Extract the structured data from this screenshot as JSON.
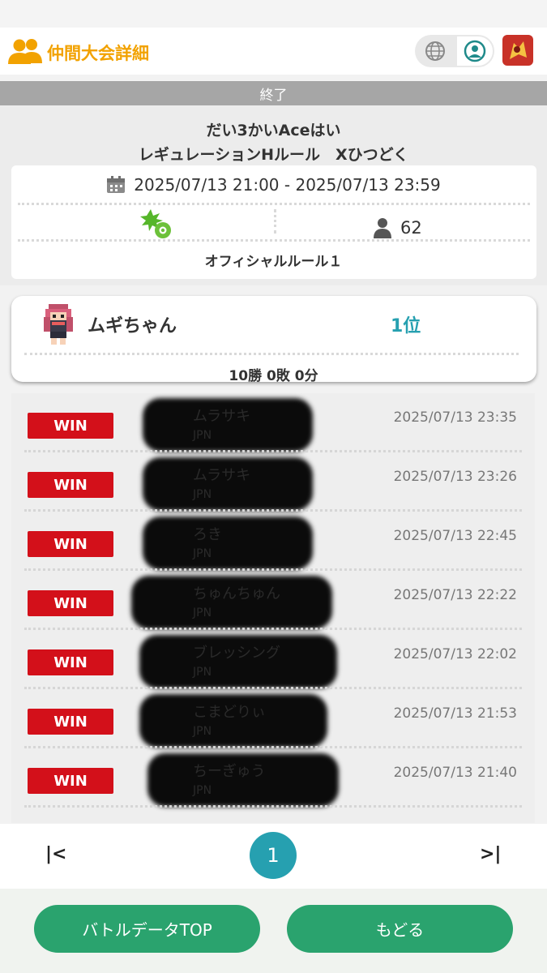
{
  "header": {
    "title": "仲間大会詳細",
    "icons": {
      "left": "people-icon",
      "lang": "globe-icon",
      "profile": "user-circle-icon",
      "app": "app-icon"
    },
    "accent_color": "#f2a200"
  },
  "event": {
    "status": "終了",
    "name": "だい3かいAceはい",
    "rule": "レギュレーションHルール　Xひつどく",
    "date_range": "2025/07/13 21:00 - 2025/07/13 23:59",
    "participants": "62",
    "official_rule": "オフィシャルルール１",
    "icons": {
      "calendar": "calendar-icon",
      "rule": "rule-ball-icon",
      "players": "person-icon"
    }
  },
  "player": {
    "name": "ムギちゃん",
    "rank": "1位",
    "record": "10勝 0敗 0分",
    "rank_color": "#26a0b0"
  },
  "battles": [
    {
      "result": "WIN",
      "opponent": "ムラサキ",
      "country": "JPN",
      "time": "2025/07/13 23:35"
    },
    {
      "result": "WIN",
      "opponent": "ムラサキ",
      "country": "JPN",
      "time": "2025/07/13 23:26"
    },
    {
      "result": "WIN",
      "opponent": "ろき",
      "country": "JPN",
      "time": "2025/07/13 22:45"
    },
    {
      "result": "WIN",
      "opponent": "ちゅんちゅん",
      "country": "JPN",
      "time": "2025/07/13 22:22"
    },
    {
      "result": "WIN",
      "opponent": "ブレッシング",
      "country": "JPN",
      "time": "2025/07/13 22:02"
    },
    {
      "result": "WIN",
      "opponent": "こまどりぃ",
      "country": "JPN",
      "time": "2025/07/13 21:53"
    },
    {
      "result": "WIN",
      "opponent": "ちーぎゅう",
      "country": "JPN",
      "time": "2025/07/13 21:40"
    }
  ],
  "win_color": "#d3101a",
  "pager": {
    "first": "|<",
    "current": "1",
    "last": ">|"
  },
  "buttons": {
    "battle_top": "バトルデータTOP",
    "back": "もどる",
    "color": "#2aa36e"
  }
}
